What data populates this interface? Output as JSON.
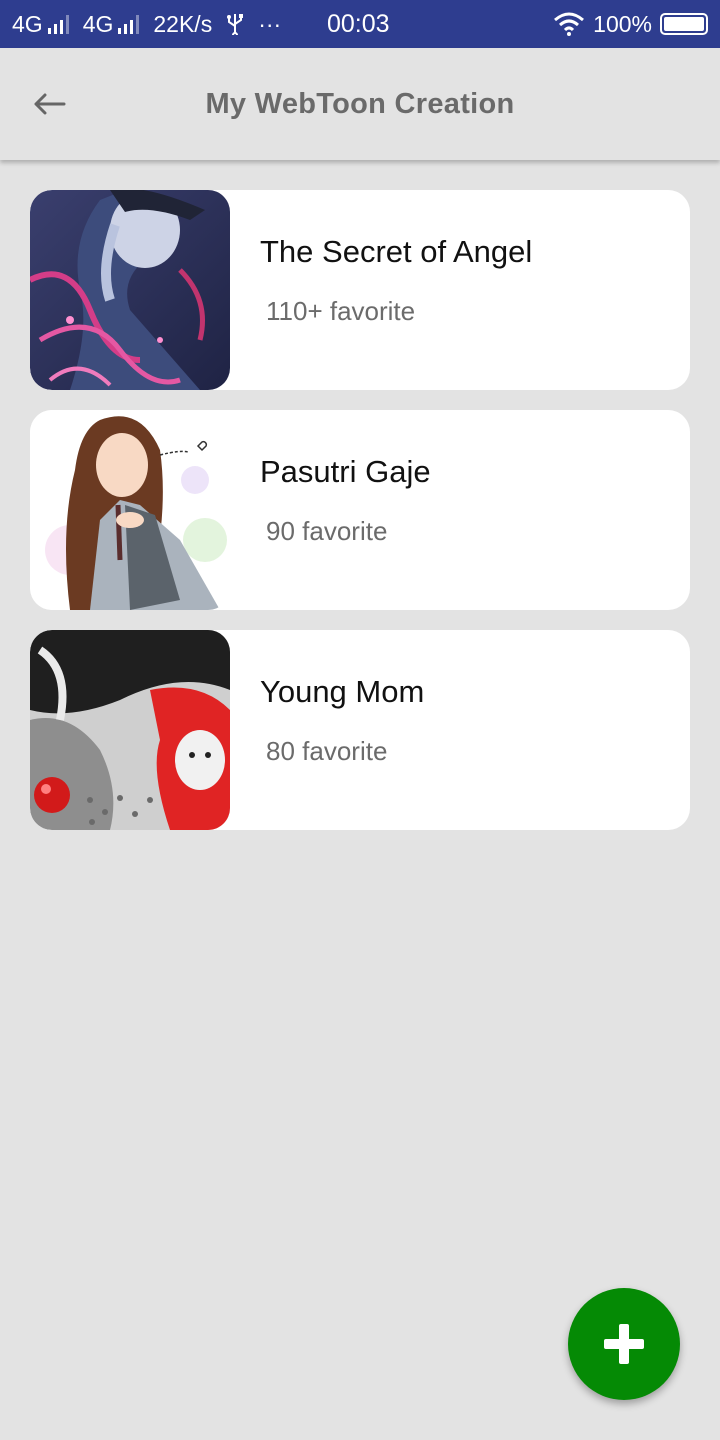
{
  "status_bar": {
    "network1": "4G",
    "network2": "4G",
    "speed": "22K/s",
    "usb_icon": "usb-icon",
    "more": "···",
    "time": "00:03",
    "battery": "100%"
  },
  "app_bar": {
    "back_icon": "arrow-left-icon",
    "title": "My WebToon Creation"
  },
  "webtoons": [
    {
      "title": "The Secret of Angel",
      "favorites": "110+ favorite",
      "cover": "dark-fantasy-cover"
    },
    {
      "title": "Pasutri Gaje",
      "favorites": "90 favorite",
      "cover": "schoolgirl-cover"
    },
    {
      "title": "Young Mom",
      "favorites": "80 favorite",
      "cover": "monochrome-red-cover"
    }
  ],
  "fab": {
    "icon": "plus-icon",
    "color": "#058a05"
  },
  "colors": {
    "status_bar": "#2e3d8f",
    "background": "#e3e3e3",
    "card": "#ffffff"
  }
}
